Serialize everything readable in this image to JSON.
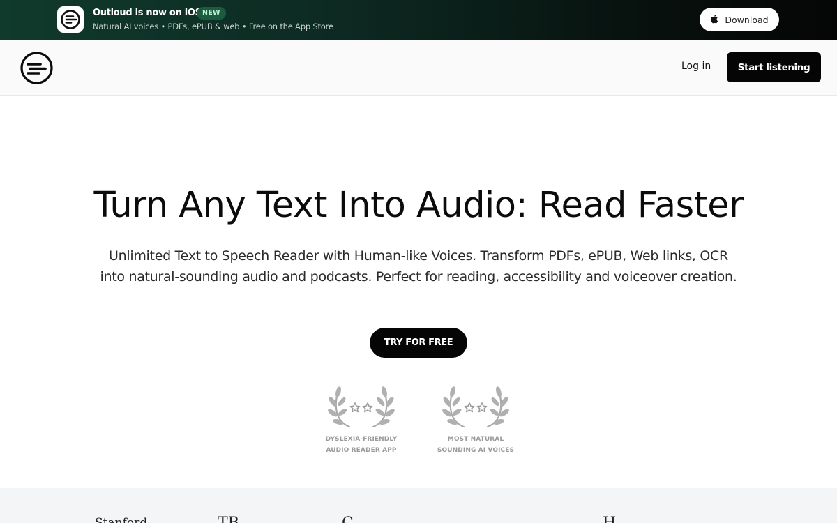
{
  "banner": {
    "title": "Outloud is now on iOS",
    "badge": "NEW",
    "subtitle": "Natural AI voices • PDFs, ePUB & web • Free on the App Store",
    "download_label": "Download"
  },
  "nav": {
    "login_label": "Log in",
    "cta_label": "Start listening"
  },
  "hero": {
    "title": "Turn Any Text Into Audio: Read Faster",
    "description": "Unlimited Text to Speech Reader with Human-like Voices. Transform PDFs, ePUB, Web links, OCR into natural-sounding audio and podcasts. Perfect for reading, accessibility and voiceover creation.",
    "cta_label": "TRY FOR FREE"
  },
  "awards": [
    {
      "line1": "DYSLEXIA-FRIENDLY",
      "line2": "AUDIO READER APP"
    },
    {
      "line1": "MOST NATURAL",
      "line2": "SOUNDING AI VOICES"
    }
  ],
  "logos": [
    "Stanford",
    "TB",
    "C",
    "H"
  ],
  "colors": {
    "banner_start": "#103a2c",
    "banner_end": "#050505",
    "badge_bg": "#1c5b3f",
    "badge_text": "#b9f5d0",
    "button_dark": "#050505",
    "award_gray": "#9a9a9a"
  },
  "icons": [
    "outloud-logo-icon",
    "apple-icon",
    "laurel-icon",
    "star-icon"
  ]
}
